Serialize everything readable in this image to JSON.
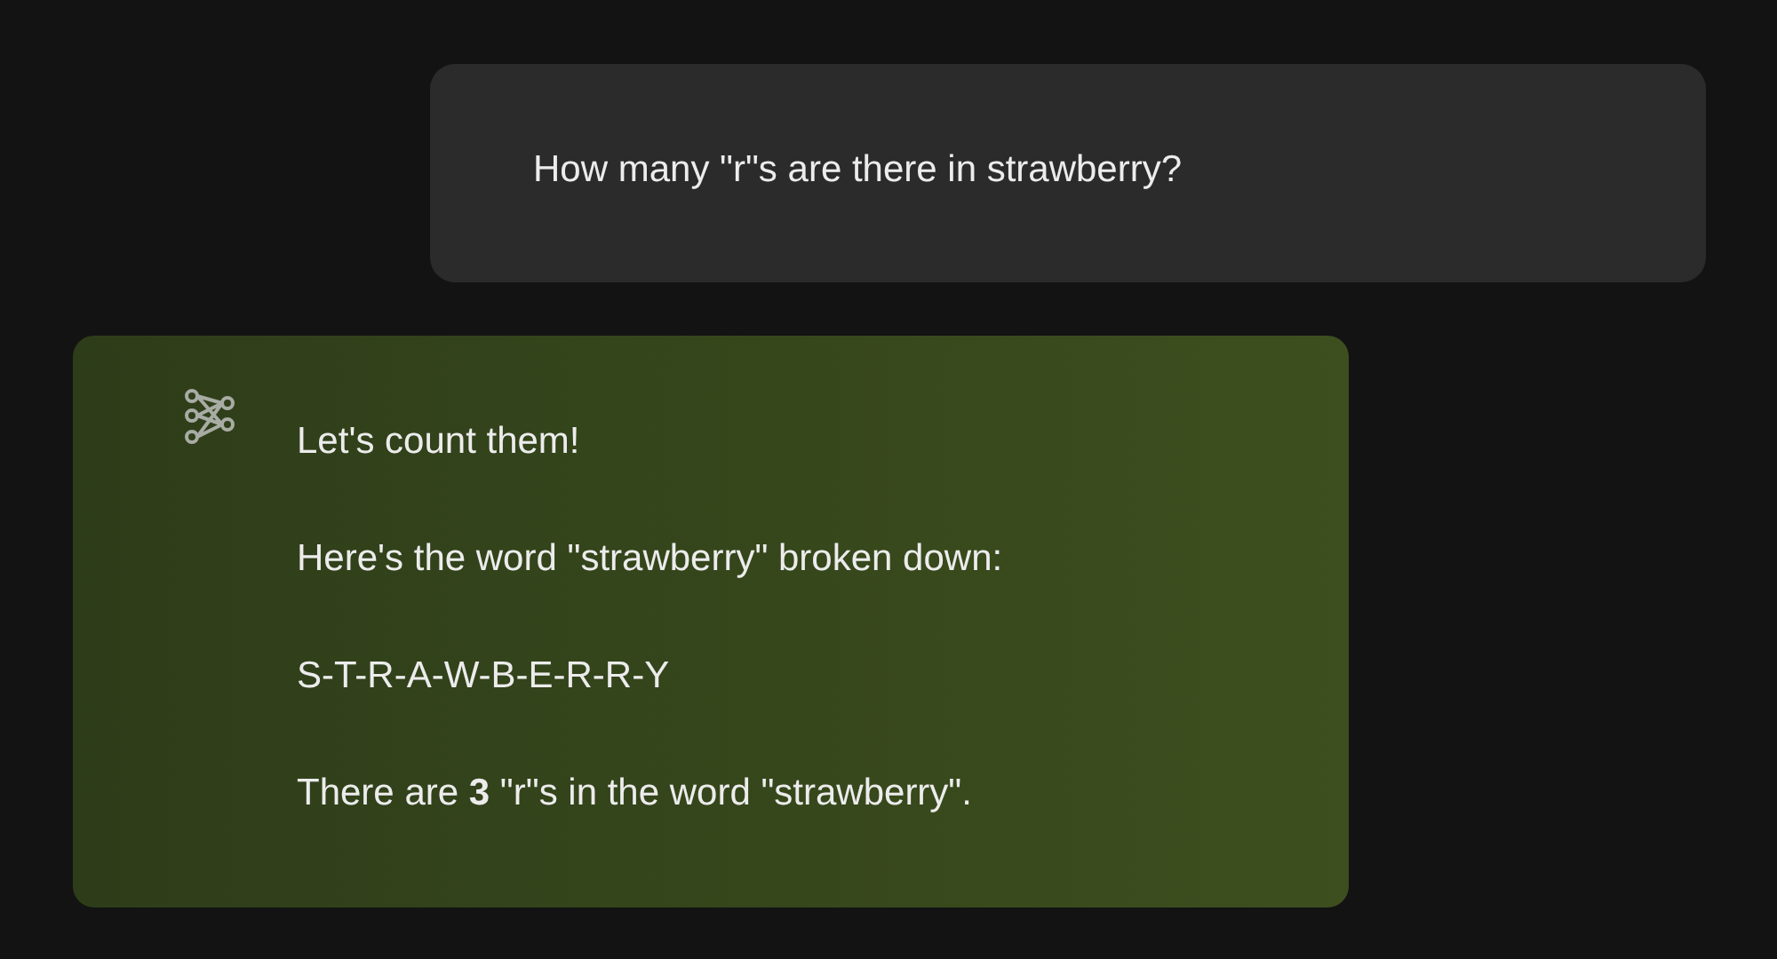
{
  "messages": [
    {
      "kind": "user",
      "paragraphs": [
        "How many \"r\"s are there in strawberry?"
      ]
    },
    {
      "kind": "assistant",
      "paragraphs": [
        "Let's count them!",
        "Here's the word \"strawberry\" broken down:",
        "S-T-R-A-W-B-E-R-R-Y",
        "There are **3** \"r\"s in the word \"strawberry\"."
      ]
    }
  ]
}
